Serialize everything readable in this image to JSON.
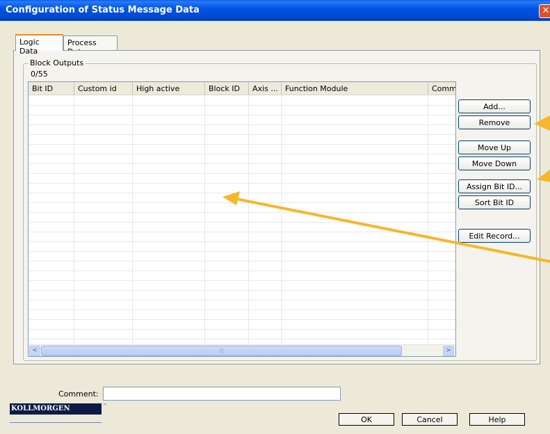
{
  "window": {
    "title": "Configuration of Status Message Data",
    "close_label": "✕"
  },
  "tabs": [
    {
      "label": "Logic Data",
      "active": true
    },
    {
      "label": "Process Data",
      "active": false
    }
  ],
  "group": {
    "label": "Block Outputs",
    "count": "0/55"
  },
  "table": {
    "columns": [
      "Bit ID",
      "Custom id",
      "High active",
      "Block ID",
      "Axis ...",
      "Function Module",
      "Comme"
    ],
    "rows": []
  },
  "scrollbar": {
    "left_arrow": "<",
    "right_arrow": ">",
    "thumb_grip": "|||"
  },
  "buttons": {
    "add": "Add...",
    "remove": "Remove",
    "move_up": "Move Up",
    "move_down": "Move Down",
    "assign_bit_id": "Assign Bit ID...",
    "sort_bit_id": "Sort Bit ID",
    "edit_record": "Edit Record..."
  },
  "comment": {
    "label": "Comment:",
    "value": ""
  },
  "logo": {
    "text": "KOLLMORGEN",
    "tm": "™"
  },
  "footer": {
    "ok": "OK",
    "cancel": "Cancel",
    "help": "Help"
  },
  "colors": {
    "titlebar": "#0054e3",
    "annotation_arrow": "#f5b82b"
  }
}
